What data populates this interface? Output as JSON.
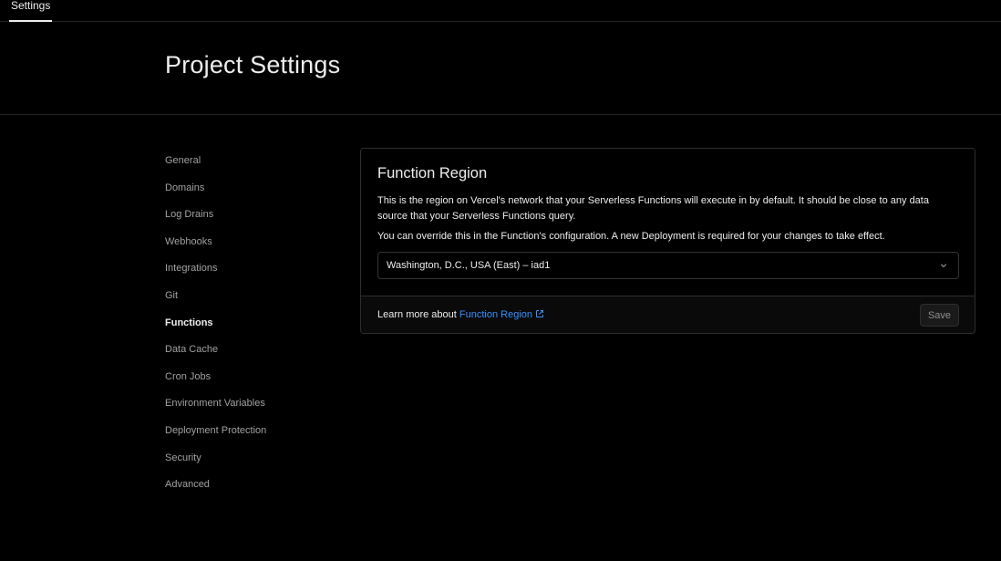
{
  "topbar": {
    "tabs": [
      {
        "label": "Settings",
        "active": true
      }
    ]
  },
  "page": {
    "title": "Project Settings"
  },
  "sidebar": {
    "items": [
      {
        "label": "General"
      },
      {
        "label": "Domains"
      },
      {
        "label": "Log Drains"
      },
      {
        "label": "Webhooks"
      },
      {
        "label": "Integrations"
      },
      {
        "label": "Git"
      },
      {
        "label": "Functions",
        "active": true
      },
      {
        "label": "Data Cache"
      },
      {
        "label": "Cron Jobs"
      },
      {
        "label": "Environment Variables"
      },
      {
        "label": "Deployment Protection"
      },
      {
        "label": "Security"
      },
      {
        "label": "Advanced"
      }
    ]
  },
  "function_region": {
    "title": "Function Region",
    "description": "This is the region on Vercel's network that your Serverless Functions will execute in by default. It should be close to any data source that your Serverless Functions query.",
    "note": "You can override this in the Function's configuration. A new Deployment is required for your changes to take effect.",
    "select": {
      "value": "Washington, D.C., USA (East) – iad1",
      "icon": "chevron-down-icon"
    },
    "footer": {
      "text": "Learn more about",
      "link_label": "Function Region",
      "link_icon": "external-link-icon",
      "save_label": "Save"
    }
  },
  "colors": {
    "background": "#000000",
    "text": "#ededed",
    "muted": "#a1a1a1",
    "link": "#3291ff",
    "border": "#2e2e2e"
  }
}
